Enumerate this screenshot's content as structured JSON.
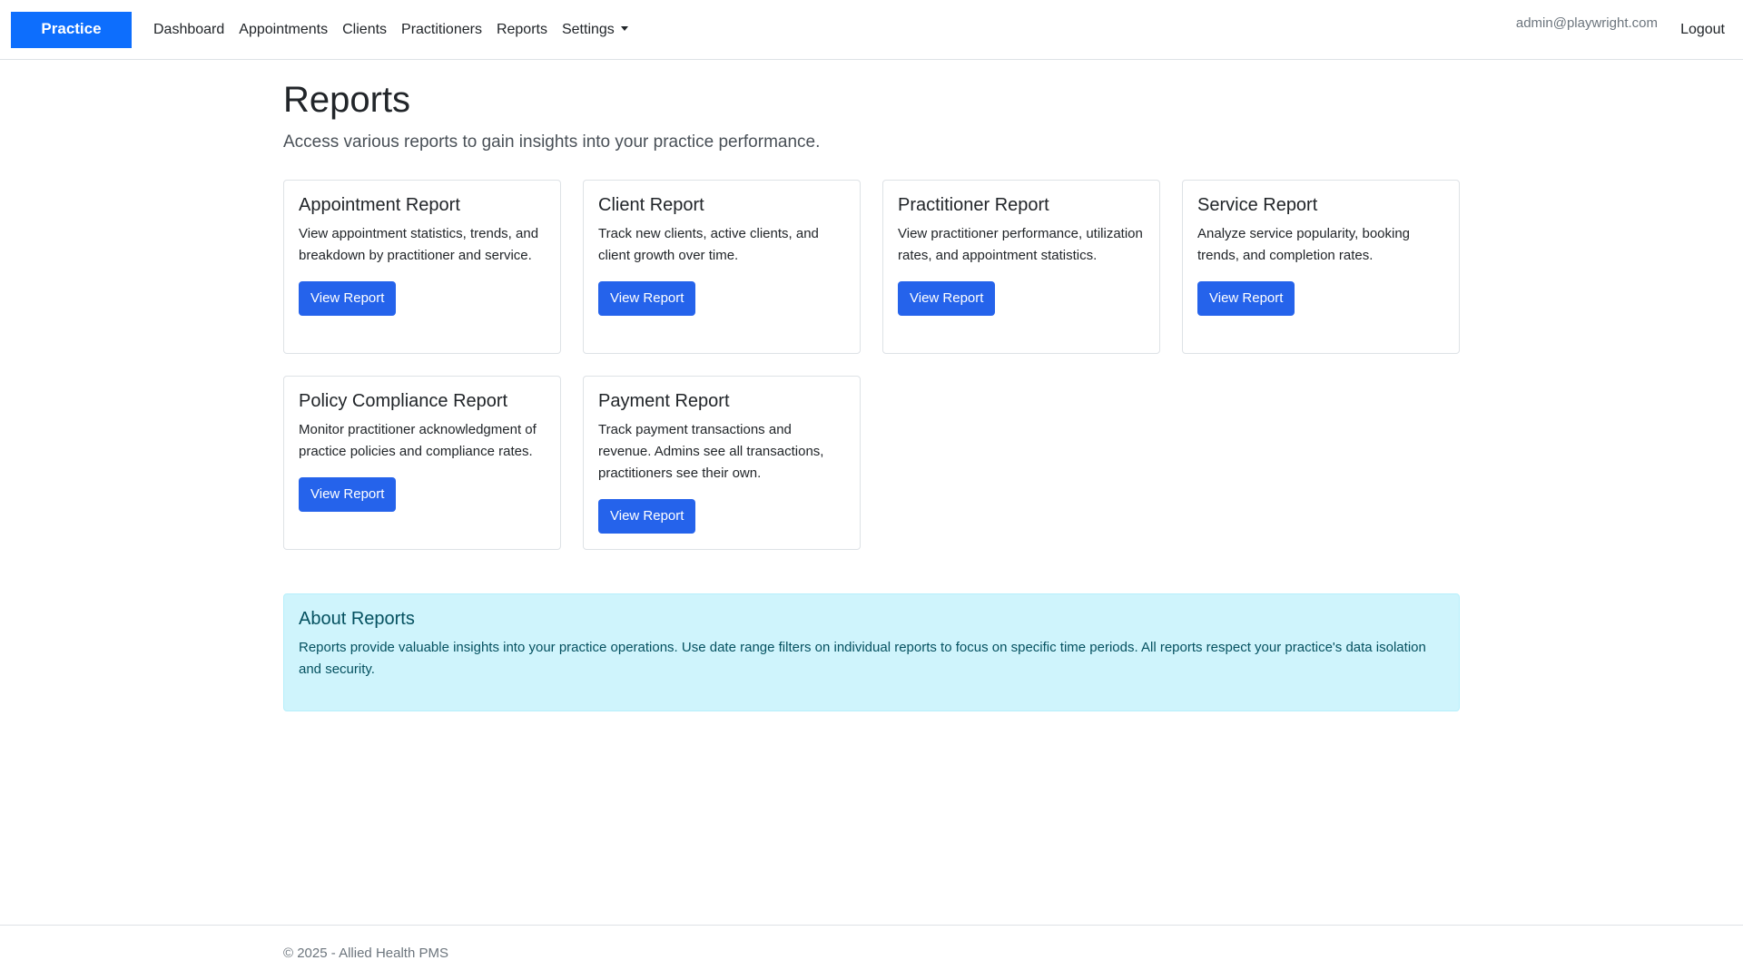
{
  "navbar": {
    "brand": "Practice",
    "links": [
      "Dashboard",
      "Appointments",
      "Clients",
      "Practitioners",
      "Reports"
    ],
    "settings_label": "Settings",
    "user_email": "admin@playwright.com",
    "logout_label": "Logout"
  },
  "page": {
    "title": "Reports",
    "subtitle": "Access various reports to gain insights into your practice performance."
  },
  "cards": [
    {
      "title": "Appointment Report",
      "text": "View appointment statistics, trends, and breakdown by practitioner and service.",
      "button": "View Report"
    },
    {
      "title": "Client Report",
      "text": "Track new clients, active clients, and client growth over time.",
      "button": "View Report"
    },
    {
      "title": "Practitioner Report",
      "text": "View practitioner performance, utilization rates, and appointment statistics.",
      "button": "View Report"
    },
    {
      "title": "Service Report",
      "text": "Analyze service popularity, booking trends, and completion rates.",
      "button": "View Report"
    },
    {
      "title": "Policy Compliance Report",
      "text": "Monitor practitioner acknowledgment of practice policies and compliance rates.",
      "button": "View Report"
    },
    {
      "title": "Payment Report",
      "text": "Track payment transactions and revenue. Admins see all transactions, practitioners see their own.",
      "button": "View Report"
    }
  ],
  "info": {
    "title": "About Reports",
    "text": "Reports provide valuable insights into your practice operations. Use date range filters on individual reports to focus on specific time periods. All reports respect your practice's data isolation and security."
  },
  "footer": {
    "text": "© 2025 - Allied Health PMS"
  },
  "colors": {
    "brand": "#0d6efd",
    "button": "#2563eb",
    "info_bg": "#cff4fc",
    "info_text": "#055160"
  }
}
